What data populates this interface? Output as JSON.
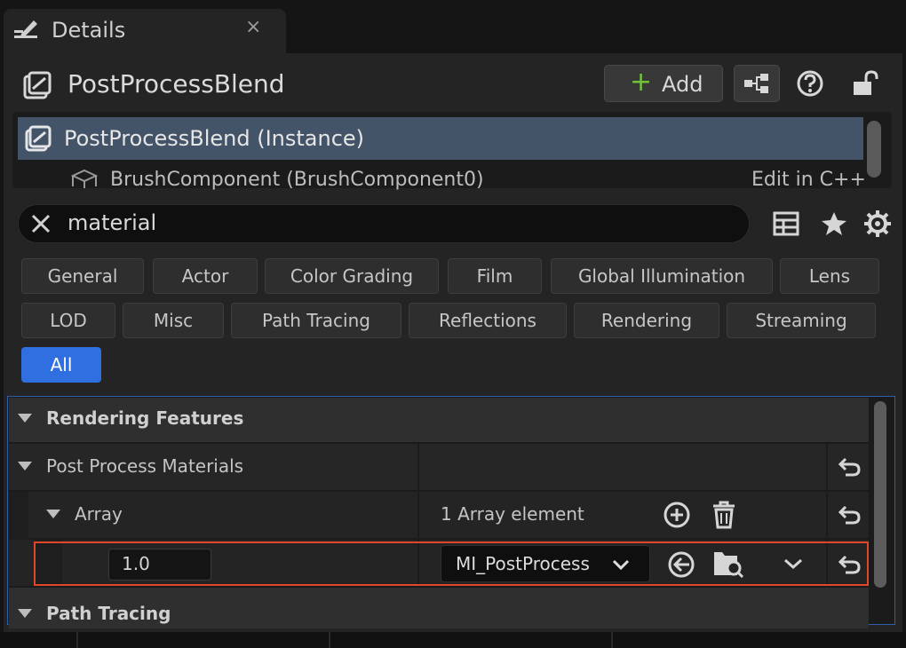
{
  "tab": {
    "title": "Details",
    "close": "×"
  },
  "header": {
    "title": "PostProcessBlend",
    "add_label": "Add",
    "add_plus": "+"
  },
  "tree": {
    "selected": "PostProcessBlend (Instance)",
    "row2": "BrushComponent (BrushComponent0)",
    "row2_action": "Edit in C++"
  },
  "search": {
    "value": "material"
  },
  "filters": {
    "row1": [
      "General",
      "Actor",
      "Color Grading",
      "Film",
      "Global Illumination",
      "Lens"
    ],
    "row2": [
      "LOD",
      "Misc",
      "Path Tracing",
      "Reflections",
      "Rendering",
      "Streaming"
    ],
    "row3": [
      "All"
    ]
  },
  "grid": {
    "cat_rendering": "Rendering Features",
    "post_process_materials": "Post Process Materials",
    "array_label": "Array",
    "array_count": "1 Array element",
    "element_weight": "1.0",
    "element_asset": "MI_PostProcess",
    "cat_path_tracing": "Path Tracing"
  },
  "colors": {
    "accent": "#2f6fe0",
    "highlight": "#e0462a",
    "selection": "#435368",
    "add_plus": "#71c23a"
  },
  "icons": [
    "details-pencil-icon",
    "close-icon",
    "actor-icon",
    "blueprint-icon",
    "help-icon",
    "lock-icon",
    "table-view-icon",
    "star-icon",
    "settings-gear-icon",
    "expand-triangle-icon",
    "add-element-icon",
    "delete-icon",
    "reset-arrow-icon",
    "use-selected-icon",
    "browse-asset-icon",
    "chevron-down-icon"
  ]
}
